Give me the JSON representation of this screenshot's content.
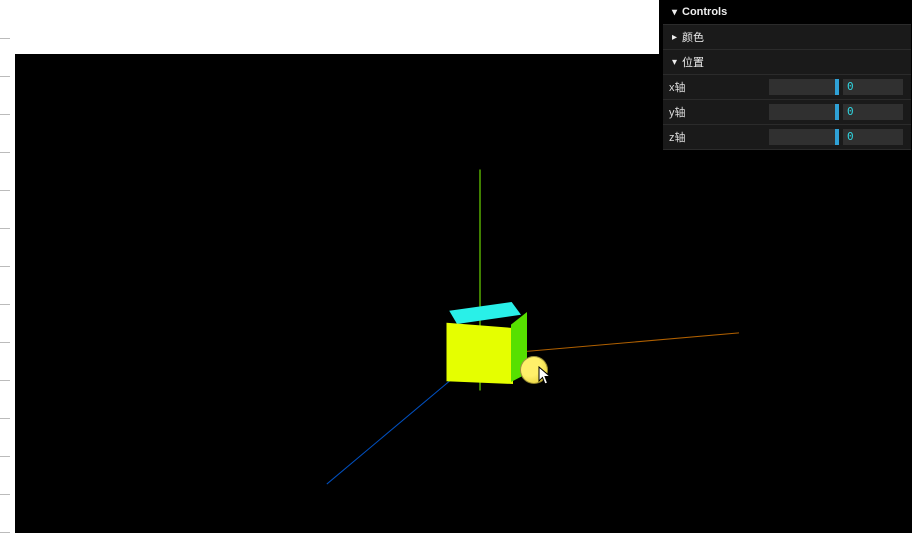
{
  "panel": {
    "title": "Controls",
    "sections": [
      {
        "label": "颜色",
        "expanded": false
      },
      {
        "label": "位置",
        "expanded": true,
        "fields": [
          {
            "label": "x轴",
            "value": "0"
          },
          {
            "label": "y轴",
            "value": "0"
          },
          {
            "label": "z轴",
            "value": "0"
          }
        ]
      }
    ]
  },
  "scene": {
    "axes": {
      "x": "orange",
      "y": "lime",
      "z": "blue"
    },
    "cube": {
      "front_color": "#e5ff00",
      "top_color": "#29f0e8",
      "side_color": "#56e000"
    },
    "cursor_highlight_color": "#f0d850"
  }
}
